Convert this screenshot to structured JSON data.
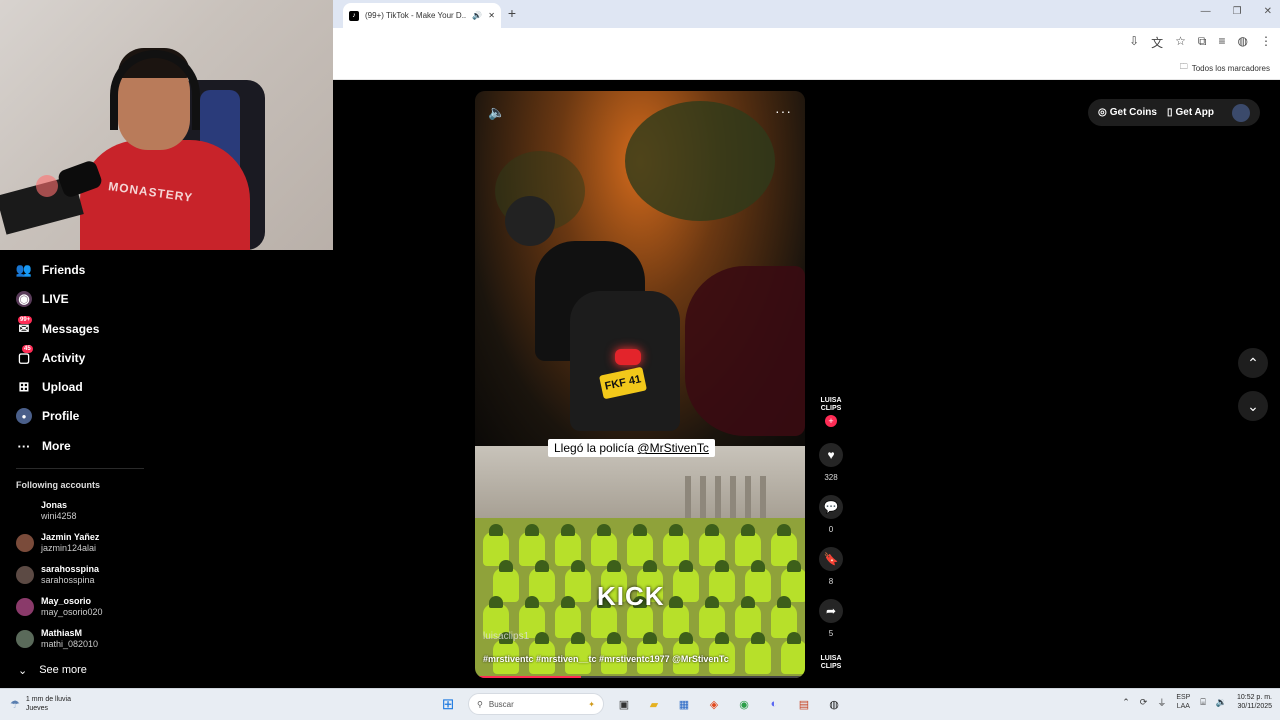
{
  "browser": {
    "tab_title": "(99+) TikTok - Make Your D...",
    "new_tab_label": "+",
    "bookmarks_all": "Todos los marcadores"
  },
  "webcam": {
    "shirt_text": "MONASTERY"
  },
  "sidebar": {
    "items": [
      {
        "label": "Friends",
        "icon": "friends-icon",
        "glyph": "👥"
      },
      {
        "label": "LIVE",
        "icon": "live-icon",
        "glyph": "◉"
      },
      {
        "label": "Messages",
        "icon": "messages-icon",
        "glyph": "✉",
        "badge": "99+"
      },
      {
        "label": "Activity",
        "icon": "activity-icon",
        "glyph": "▢",
        "badge": "45"
      },
      {
        "label": "Upload",
        "icon": "upload-icon",
        "glyph": "⊞"
      },
      {
        "label": "Profile",
        "icon": "profile-icon",
        "glyph": "●"
      },
      {
        "label": "More",
        "icon": "more-icon",
        "glyph": "···"
      }
    ],
    "following_title": "Following accounts",
    "accounts": [
      {
        "name": "Jonas",
        "id": "wini4258"
      },
      {
        "name": "Jazmin Yañez",
        "id": "jazmin124alai"
      },
      {
        "name": "sarahosspina",
        "id": "sarahosspina"
      },
      {
        "name": "May_osorio",
        "id": "may_osorio020"
      },
      {
        "name": "MathiasM",
        "id": "mathi_082010"
      }
    ],
    "see_more": "See more"
  },
  "video": {
    "plate": "FKF 41",
    "caption_text": "Llegó la policía ",
    "caption_mention": "@MrStivenTc",
    "watermark": "KICK",
    "author": "luisaclips1",
    "tags": "#mrstiventc #mrstiven__tc #mrstiventc1977 @MrStivenTc",
    "progress": 0.32
  },
  "actions": {
    "creator_logo": "LUISA CLIPS",
    "likes": "328",
    "comments": "0",
    "saves": "8",
    "shares": "5",
    "music_logo": "LUISA CLIPS"
  },
  "topright": {
    "coins": "Get Coins",
    "app": "Get App"
  },
  "taskbar": {
    "weather_line1": "1 mm de lluvia",
    "weather_line2": "Jueves",
    "search_placeholder": "Buscar",
    "lang_line1": "ESP",
    "lang_line2": "LAA",
    "time": "10:52 p. m.",
    "date": "30/11/2025"
  }
}
